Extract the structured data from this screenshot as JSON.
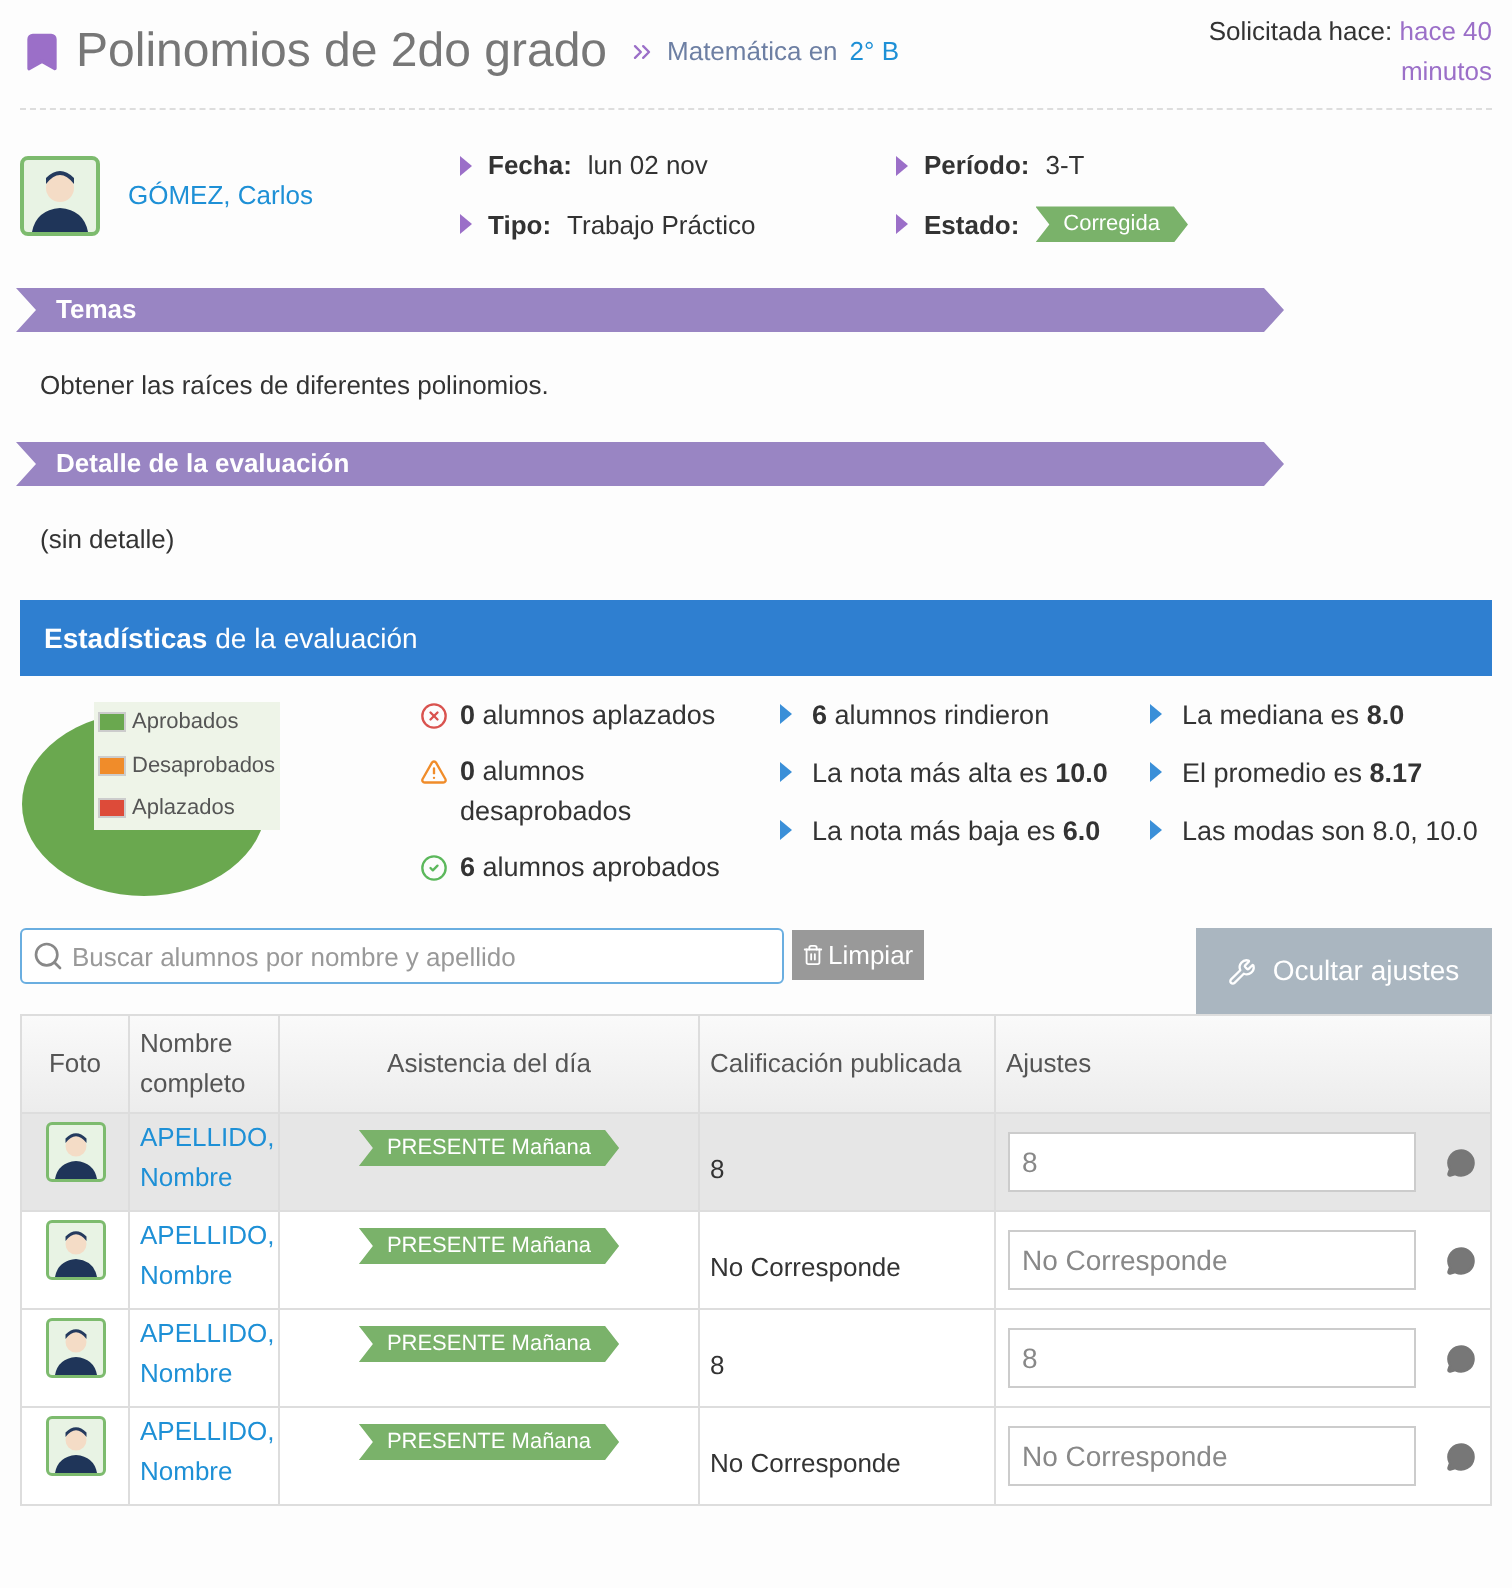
{
  "header": {
    "title": "Polinomios de 2do grado",
    "subject": "Matemática en",
    "course": "2° B",
    "requested_label": "Solicitada hace:",
    "requested_value": "hace 40 minutos"
  },
  "teacher": {
    "name": "GÓMEZ, Carlos"
  },
  "info": [
    {
      "label": "Fecha:",
      "value": "lun 02 nov",
      "kind": "text"
    },
    {
      "label": "Período:",
      "value": "3-T",
      "kind": "text"
    },
    {
      "label": "Tipo:",
      "value": "Trabajo Práctico",
      "kind": "text"
    },
    {
      "label": "Estado:",
      "value": "Corregida",
      "kind": "tag"
    }
  ],
  "sections": [
    {
      "title": "Temas",
      "body": "Obtener las raíces de diferentes polinomios."
    },
    {
      "title": "Detalle de la evaluación",
      "body": "(sin detalle)"
    }
  ],
  "stats": {
    "title_bold": "Estadísticas",
    "title_rest": "de la evaluación",
    "legend": [
      {
        "label": "Aprobados",
        "color": "#6aa84f"
      },
      {
        "label": "Desaprobados",
        "color": "#f08c2a"
      },
      {
        "label": "Aplazados",
        "color": "#dd4b39"
      }
    ],
    "status_items": [
      {
        "kind": "fail",
        "count": "0",
        "text": "alumnos aplazados"
      },
      {
        "kind": "warn",
        "count": "0",
        "text": "alumnos desaprobados"
      },
      {
        "kind": "ok",
        "count": "6",
        "text": "alumnos aprobados"
      }
    ],
    "facts": [
      {
        "text": "**6** alumnos rindieron"
      },
      {
        "text": "La nota más alta es **10.0**"
      },
      {
        "text": "La nota más baja es **6.0**"
      }
    ],
    "facts2": [
      {
        "text": "La mediana es **8.0**"
      },
      {
        "text": "El promedio es **8.17**"
      },
      {
        "text": "Las modas son 8.0, 10.0"
      }
    ]
  },
  "search": {
    "placeholder": "Buscar alumnos por nombre y apellido"
  },
  "clear_button": "Limpiar",
  "toggle_button": "Ocultar ajustes",
  "table": {
    "columns": [
      "Foto",
      "Nombre completo",
      "Asistencia del día",
      "Calificación publicada",
      "Ajustes"
    ],
    "rows": [
      {
        "name": "APELLIDO, Nombre",
        "attendance": "PRESENTE Mañana",
        "grade": "8",
        "adjust": "8",
        "selected": true
      },
      {
        "name": "APELLIDO, Nombre",
        "attendance": "PRESENTE Mañana",
        "grade": "No Corresponde",
        "adjust": "No Corresponde",
        "selected": false
      },
      {
        "name": "APELLIDO, Nombre",
        "attendance": "PRESENTE Mañana",
        "grade": "8",
        "adjust": "8",
        "selected": false
      },
      {
        "name": "APELLIDO, Nombre",
        "attendance": "PRESENTE Mañana",
        "grade": "No Corresponde",
        "adjust": "No Corresponde",
        "selected": false
      }
    ]
  }
}
